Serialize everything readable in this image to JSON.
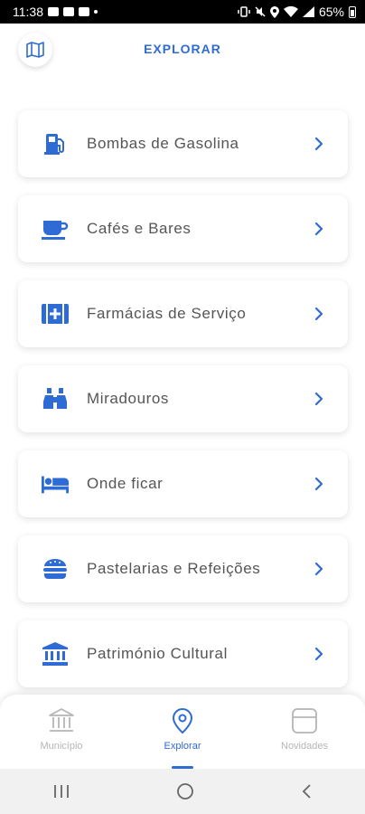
{
  "status_bar": {
    "time": "11:38",
    "battery": "65%"
  },
  "header": {
    "title": "EXPLORAR",
    "map_icon": "map-icon"
  },
  "categories": [
    {
      "label": "Bombas de Gasolina",
      "icon": "gas-pump-icon"
    },
    {
      "label": "Cafés e Bares",
      "icon": "coffee-cup-icon"
    },
    {
      "label": "Farmácias de Serviço",
      "icon": "pharmacy-icon"
    },
    {
      "label": "Miradouros",
      "icon": "binoculars-icon"
    },
    {
      "label": "Onde ficar",
      "icon": "bed-icon"
    },
    {
      "label": "Pastelarias e Refeições",
      "icon": "burger-icon"
    },
    {
      "label": "Património Cultural",
      "icon": "museum-icon"
    }
  ],
  "bottom_nav": {
    "items": [
      {
        "label": "Município",
        "icon": "municipality-icon",
        "active": false
      },
      {
        "label": "Explorar",
        "icon": "location-pin-icon",
        "active": true
      },
      {
        "label": "Novidades",
        "icon": "news-card-icon",
        "active": false
      }
    ]
  },
  "colors": {
    "accent": "#2f6bd4",
    "inactive": "#b5b5b5",
    "text": "#555555"
  }
}
